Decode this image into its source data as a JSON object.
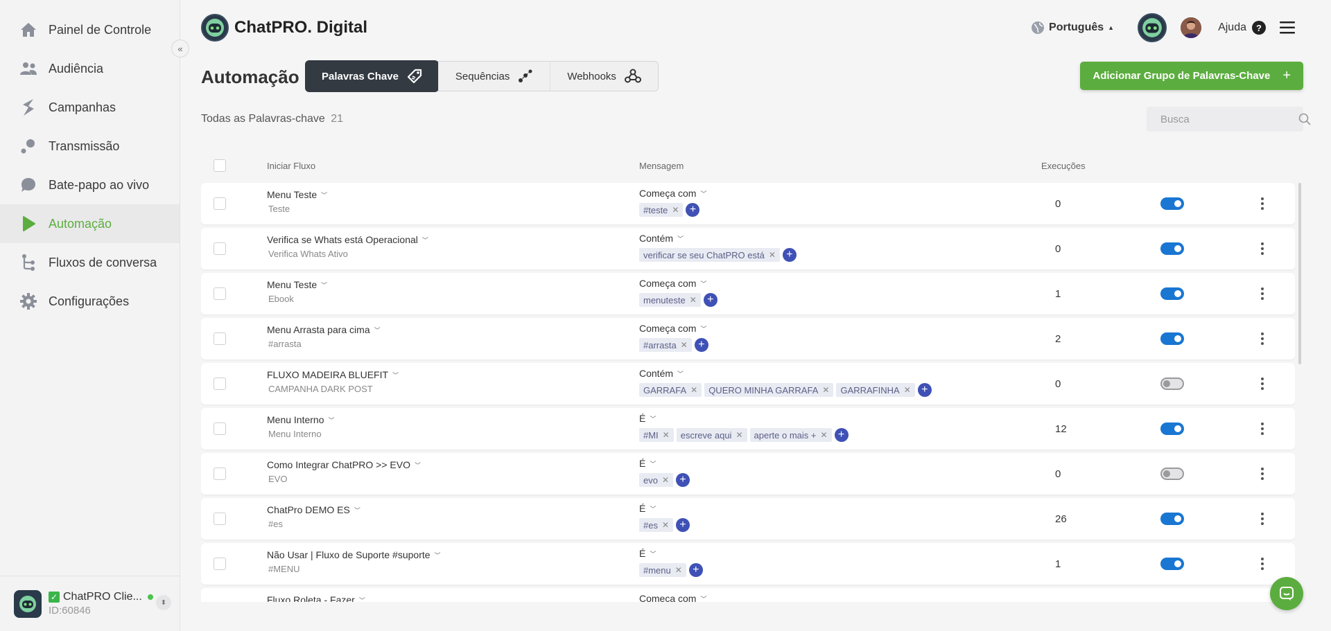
{
  "sidebar": {
    "items": [
      {
        "label": "Painel de Controle",
        "icon": "home-icon"
      },
      {
        "label": "Audiência",
        "icon": "users-icon"
      },
      {
        "label": "Campanhas",
        "icon": "bolt-icon"
      },
      {
        "label": "Transmissão",
        "icon": "broadcast-icon"
      },
      {
        "label": "Bate-papo ao vivo",
        "icon": "chat-icon"
      },
      {
        "label": "Automação",
        "icon": "play-icon",
        "active": true
      },
      {
        "label": "Fluxos de conversa",
        "icon": "flow-icon"
      },
      {
        "label": "Configurações",
        "icon": "gear-icon"
      }
    ],
    "account": {
      "name": "ChatPRO Clie...",
      "id": "ID:60846"
    }
  },
  "header": {
    "brand": "ChatPRO. Digital",
    "language": "Português",
    "help": "Ajuda"
  },
  "page": {
    "title": "Automação",
    "tabs": [
      {
        "label": "Palavras Chave",
        "active": true
      },
      {
        "label": "Sequências"
      },
      {
        "label": "Webhooks"
      }
    ],
    "add_button": "Adicionar Grupo de Palavras-Chave",
    "count_label": "Todas as Palavras-chave",
    "count": "21",
    "search_placeholder": "Busca"
  },
  "table": {
    "columns": {
      "flow": "Iniciar Fluxo",
      "message": "Mensagem",
      "executions": "Execuções"
    },
    "rows": [
      {
        "flow": "Menu Teste",
        "sub": "Teste",
        "type": "Começa com",
        "keywords": [
          "#teste"
        ],
        "exec": "0",
        "enabled": true
      },
      {
        "flow": "Verifica se Whats está Operacional",
        "sub": "Verifica Whats Ativo",
        "type": "Contém",
        "keywords": [
          "verificar se seu ChatPRO está"
        ],
        "exec": "0",
        "enabled": true
      },
      {
        "flow": "Menu Teste",
        "sub": "Ebook",
        "type": "Começa com",
        "keywords": [
          "menuteste"
        ],
        "exec": "1",
        "enabled": true
      },
      {
        "flow": "Menu Arrasta para cima",
        "sub": "#arrasta",
        "type": "Começa com",
        "keywords": [
          "#arrasta"
        ],
        "exec": "2",
        "enabled": true
      },
      {
        "flow": "FLUXO MADEIRA BLUEFIT",
        "sub": "CAMPANHA DARK POST",
        "type": "Contém",
        "keywords": [
          "GARRAFA",
          "QUERO MINHA GARRAFA",
          "GARRAFINHA"
        ],
        "exec": "0",
        "enabled": false
      },
      {
        "flow": "Menu Interno",
        "sub": "Menu Interno",
        "type": "É",
        "keywords": [
          "#MI",
          "escreve aqui",
          "aperte o mais +"
        ],
        "exec": "12",
        "enabled": true
      },
      {
        "flow": "Como Integrar ChatPRO >> EVO",
        "sub": "EVO",
        "type": "É",
        "keywords": [
          "evo"
        ],
        "exec": "0",
        "enabled": false
      },
      {
        "flow": "ChatPro DEMO ES",
        "sub": "#es",
        "type": "É",
        "keywords": [
          "#es"
        ],
        "exec": "26",
        "enabled": true
      },
      {
        "flow": "Não Usar | Fluxo de Suporte #suporte",
        "sub": "#MENU",
        "type": "É",
        "keywords": [
          "#menu"
        ],
        "exec": "1",
        "enabled": true
      },
      {
        "flow": "Fluxo Roleta - Fazer",
        "sub": "",
        "type": "Começa com",
        "keywords": [],
        "exec": "",
        "enabled": true
      }
    ]
  }
}
